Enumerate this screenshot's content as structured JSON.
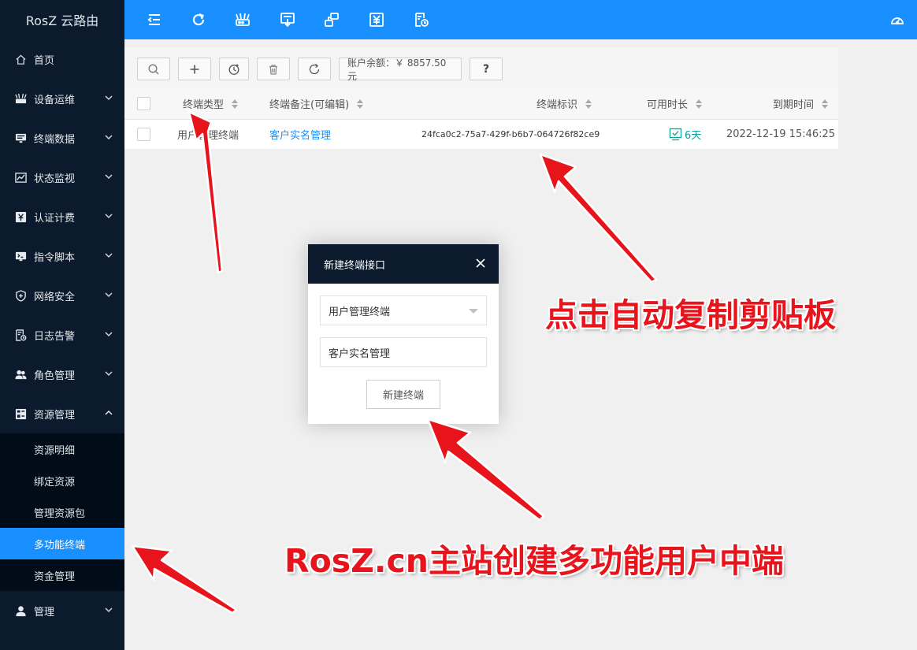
{
  "app": {
    "logo": "RosZ 云路由"
  },
  "sidebar": {
    "items": [
      {
        "label": "首页",
        "icon": "home-icon"
      },
      {
        "label": "设备运维",
        "icon": "router-icon"
      },
      {
        "label": "终端数据",
        "icon": "monitor-icon"
      },
      {
        "label": "状态监视",
        "icon": "chart-icon"
      },
      {
        "label": "认证计费",
        "icon": "billing-icon"
      },
      {
        "label": "指令脚本",
        "icon": "script-icon"
      },
      {
        "label": "网络安全",
        "icon": "shield-icon"
      },
      {
        "label": "日志告警",
        "icon": "log-icon"
      },
      {
        "label": "角色管理",
        "icon": "users-icon"
      },
      {
        "label": "资源管理",
        "icon": "resource-icon"
      },
      {
        "label": "管理",
        "icon": "user-icon"
      }
    ],
    "submenu": [
      "资源明细",
      "绑定资源",
      "管理资源包",
      "多功能终端",
      "资金管理"
    ],
    "active_sub": "多功能终端"
  },
  "toolbar": {
    "balance": "账户余额：￥ 8857.50 元",
    "help": "?"
  },
  "table": {
    "headers": [
      "终端类型",
      "终端备注(可编辑)",
      "终端标识",
      "可用时长",
      "到期时间"
    ],
    "rows": [
      {
        "type": "用户管理终端",
        "note": "客户实名管理",
        "id": "24fca0c2-75a7-429f-b6b7-064726f82ce9",
        "duration": "6天",
        "expires": "2022-12-19 15:46:25"
      }
    ]
  },
  "modal": {
    "title": "新建终端接口",
    "select_value": "用户管理终端",
    "input_value": "客户实名管理",
    "submit_label": "新建终端"
  },
  "annotations": {
    "copy_hint": "点击自动复制剪贴板",
    "main_caption": "RosZ.cn主站创建多功能用户中端"
  },
  "colors": {
    "primary": "#1890ff",
    "sidebar": "#0b1a2c",
    "annotation": "#e8141c",
    "teal": "#0aa39a"
  }
}
